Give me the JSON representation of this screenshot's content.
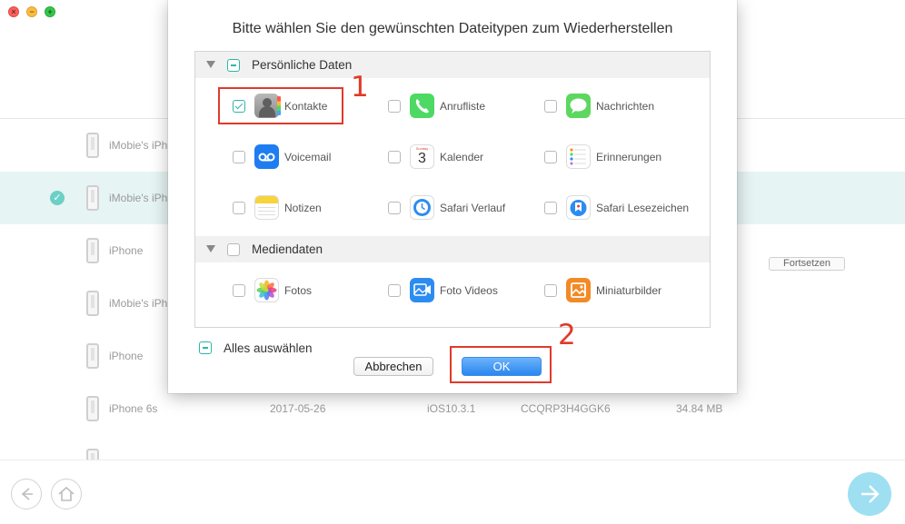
{
  "window": {
    "close_glyph": "×",
    "minimize_glyph": "−",
    "zoom_glyph": "+"
  },
  "devices": {
    "continue_label": "Fortsetzen",
    "rows": [
      {
        "name": "iMobie's iPh",
        "date": "",
        "ios": "",
        "serial": "",
        "size": ""
      },
      {
        "name": "iMobie's iPh",
        "date": "",
        "ios": "",
        "serial": "",
        "size": ""
      },
      {
        "name": "iPhone",
        "date": "",
        "ios": "",
        "serial": "",
        "size": ""
      },
      {
        "name": "iMobie's iPh",
        "date": "",
        "ios": "",
        "serial": "",
        "size": ""
      },
      {
        "name": "iPhone",
        "date": "",
        "ios": "",
        "serial": "",
        "size": ""
      },
      {
        "name": "iPhone 6s",
        "date": "2017-05-26",
        "ios": "iOS10.3.1",
        "serial": "CCQRP3H4GGK6",
        "size": "34.84 MB"
      }
    ]
  },
  "dialog": {
    "title": "Bitte wählen Sie den gewünschten Dateitypen zum Wiederherstellen",
    "groups": [
      {
        "label": "Persönliche Daten",
        "items": [
          {
            "label": "Kontakte",
            "icon": "contacts-icon",
            "checked": true
          },
          {
            "label": "Anrufliste",
            "icon": "phone-icon",
            "checked": false
          },
          {
            "label": "Nachrichten",
            "icon": "messages-icon",
            "checked": false
          },
          {
            "label": "Voicemail",
            "icon": "voicemail-icon",
            "checked": false
          },
          {
            "label": "Kalender",
            "icon": "calendar-icon",
            "checked": false
          },
          {
            "label": "Erinnerungen",
            "icon": "reminders-icon",
            "checked": false
          },
          {
            "label": "Notizen",
            "icon": "notes-icon",
            "checked": false
          },
          {
            "label": "Safari Verlauf",
            "icon": "safari-history-icon",
            "checked": false
          },
          {
            "label": "Safari Lesezeichen",
            "icon": "safari-bookmarks-icon",
            "checked": false
          }
        ]
      },
      {
        "label": "Mediendaten",
        "items": [
          {
            "label": "Fotos",
            "icon": "photos-icon",
            "checked": false
          },
          {
            "label": "Foto Videos",
            "icon": "photo-videos-icon",
            "checked": false
          },
          {
            "label": "Miniaturbilder",
            "icon": "thumbnails-icon",
            "checked": false
          }
        ]
      }
    ],
    "calendar_day": "3",
    "calendar_weekday": "Sunday",
    "select_all_label": "Alles auswählen",
    "cancel_label": "Abbrechen",
    "ok_label": "OK"
  },
  "annotations": {
    "step1": "1",
    "step2": "2"
  },
  "colors": {
    "accent_teal": "#2eb5a7",
    "selected_row": "#e6f4f4",
    "ok_button": "#2a86f0",
    "annotation_red": "#e03a2a"
  }
}
